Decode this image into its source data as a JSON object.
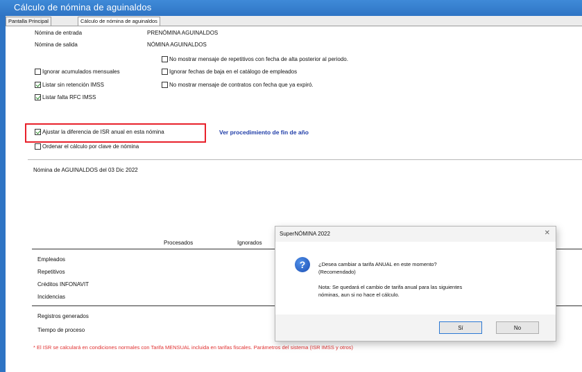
{
  "window": {
    "title": "Cálculo de nómina de aguinaldos"
  },
  "tabs": [
    {
      "label": "Pantalla Principal"
    },
    {
      "label": "Cálculo de nómina de aguinaldos"
    }
  ],
  "fields": {
    "entrada_label": "Nómina de entrada",
    "entrada_value": "PRENÓMINA AGUINALDOS",
    "salida_label": "Nómina de salida",
    "salida_value": "NÓMINA AGUINALDOS"
  },
  "checkboxes": {
    "ignorar_acumulados": {
      "label": "Ignorar acumulados mensuales",
      "checked": false
    },
    "listar_sin_retencion": {
      "label": "Listar sin retención IMSS",
      "checked": true
    },
    "listar_falta": {
      "label": "Listar falta RFC IMSS",
      "checked": true
    },
    "ajustar_isr": {
      "label": "Ajustar la diferencia de ISR anual en esta nómina",
      "checked": true
    },
    "ordenar_calculo": {
      "label": "Ordenar el cálculo por clave de nómina",
      "checked": false
    },
    "no_mostrar_repetitivos": {
      "label": "No mostrar mensaje de repetitivos con fecha de alta posterior al periodo.",
      "checked": false
    },
    "ignorar_fechas_baja": {
      "label": "Ignorar fechas de baja en el catálogo de empleados",
      "checked": false
    },
    "no_mostrar_contratos": {
      "label": "No mostrar mensaje de contratos con fecha que ya expiró.",
      "checked": false
    }
  },
  "link": {
    "label": "Ver procedimiento de fin de año"
  },
  "nomina_info": "Nómina de AGUINALDOS del 03 Dic 2022",
  "table": {
    "col_procesados": "Procesados",
    "col_ignorados": "Ignorados",
    "rows": [
      "Empleados",
      "Repetitivos",
      "Créditos INFONAVIT",
      "Incidencias"
    ],
    "footer_rows": [
      "Registros generados",
      "Tiempo de proceso"
    ]
  },
  "footnote": "* El ISR se calculará en condiciones normales con Tarifa MENSUAL incluida en tarifas fiscales. Parámetros del sistema (ISR IMSS y otros)",
  "dialog": {
    "title": "SuperNÓMINA 2022",
    "close_icon": "close-icon",
    "icon": "question-icon",
    "question_line1": "¿Desea cambiar a tarifa ANUAL en este momento?",
    "question_line2": "(Recomendado)",
    "note_line1": "Nota: Se quedará el cambio de tarifa anual para las siguientes",
    "note_line2": "nóminas, aun si no hace el cálculo.",
    "yes_label": "Sí",
    "no_label": "No"
  },
  "colors": {
    "titlebar": "#2e74c4",
    "highlight_border": "#e8202a",
    "link": "#1f3da8",
    "footnote": "#e03030"
  }
}
